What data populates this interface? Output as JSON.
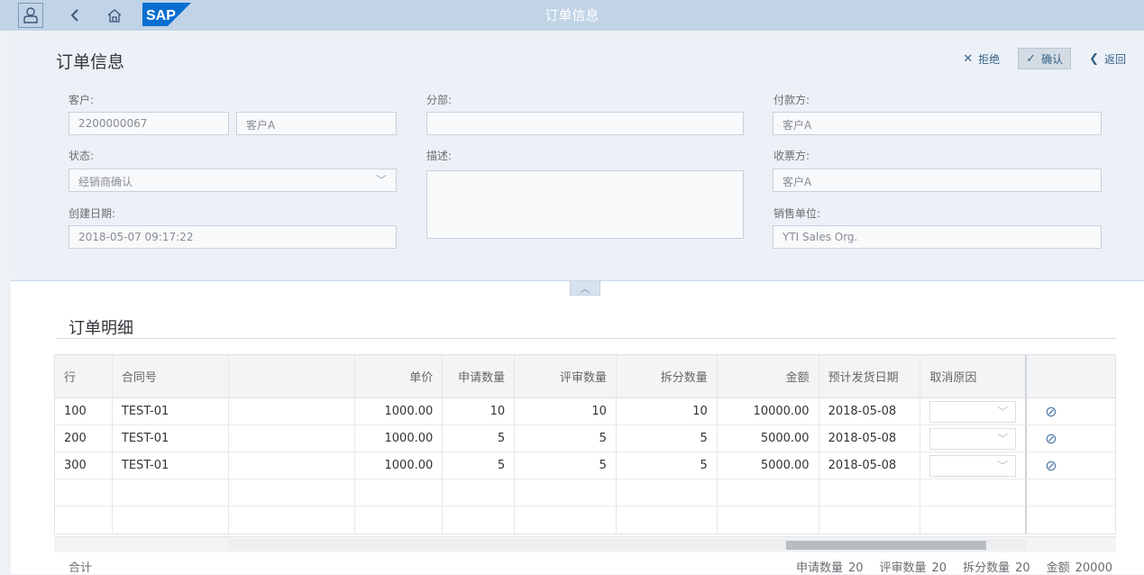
{
  "shell": {
    "title": "订单信息",
    "logo_text": "SAP",
    "brand_color": "#0a6ed1"
  },
  "header": {
    "page_title": "订单信息",
    "actions": {
      "reject": "拒绝",
      "confirm": "确认",
      "back": "返回"
    }
  },
  "form": {
    "customer_label": "客户:",
    "customer_id": "2200000067",
    "customer_name": "客户A",
    "division_label": "分部:",
    "division_value": "",
    "payer_label": "付款方:",
    "payer_value": "客户A",
    "status_label": "状态:",
    "status_value": "经销商确认",
    "description_label": "描述:",
    "description_value": "",
    "billto_label": "收票方:",
    "billto_value": "客户A",
    "created_label": "创建日期:",
    "created_value": "2018-05-07 09:17:22",
    "salesorg_label": "销售单位:",
    "salesorg_value": "YTI Sales Org."
  },
  "details": {
    "title": "订单明细",
    "columns": [
      "行",
      "合同号",
      "",
      "单价",
      "申请数量",
      "评审数量",
      "拆分数量",
      "金额",
      "预计发货日期",
      "取消原因",
      ""
    ],
    "rows": [
      {
        "line": "100",
        "contract": "TEST-01",
        "desc": "",
        "price": "1000.00",
        "req_qty": "10",
        "rev_qty": "10",
        "split_qty": "10",
        "amount": "10000.00",
        "ship_date": "2018-05-08"
      },
      {
        "line": "200",
        "contract": "TEST-01",
        "desc": "",
        "price": "1000.00",
        "req_qty": "5",
        "rev_qty": "5",
        "split_qty": "5",
        "amount": "5000.00",
        "ship_date": "2018-05-08"
      },
      {
        "line": "300",
        "contract": "TEST-01",
        "desc": "",
        "price": "1000.00",
        "req_qty": "5",
        "rev_qty": "5",
        "split_qty": "5",
        "amount": "5000.00",
        "ship_date": "2018-05-08"
      }
    ],
    "footer": {
      "total_label": "合计",
      "req_qty_label": "申请数量",
      "req_qty": "20",
      "rev_qty_label": "评审数量",
      "rev_qty": "20",
      "split_qty_label": "拆分数量",
      "split_qty": "20",
      "amount_label": "金额",
      "amount": "20000"
    }
  }
}
